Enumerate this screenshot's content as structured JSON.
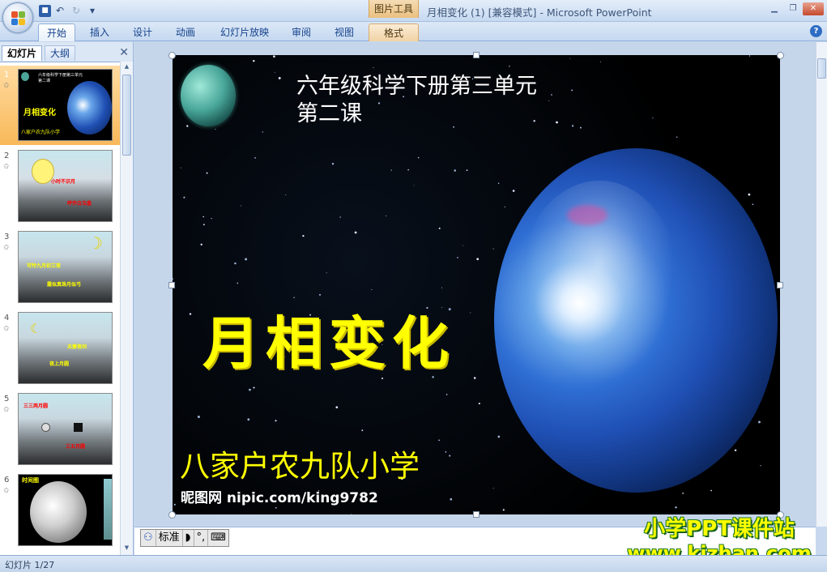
{
  "window": {
    "title": "月相变化 (1) [兼容模式] - Microsoft PowerPoint",
    "context_tab_group": "图片工具"
  },
  "qat": {
    "undo": "↶",
    "redo": "↻",
    "customize": "▾"
  },
  "ribbon": {
    "tabs": [
      "开始",
      "插入",
      "设计",
      "动画",
      "幻灯片放映",
      "审阅",
      "视图"
    ],
    "active_tab": "开始",
    "format_tab": "格式",
    "help": "?"
  },
  "left_panel": {
    "tabs": [
      "幻灯片",
      "大纲"
    ],
    "close": "✕",
    "slides": [
      {
        "num": "1",
        "texts": [
          "六年级科学下册第三单元",
          "第二课",
          "月相变化",
          "八家户农九队小学"
        ]
      },
      {
        "num": "2",
        "texts": [
          "小时不识月",
          "呼作白玉盘"
        ]
      },
      {
        "num": "3",
        "texts": [
          "可怜九月初三夜",
          "露似真珠月似弓"
        ]
      },
      {
        "num": "4",
        "texts": [
          "夫妻夜间",
          "夜上月圆"
        ]
      },
      {
        "num": "5",
        "texts": [
          "三三两月圆",
          "三五月圆"
        ]
      },
      {
        "num": "6",
        "texts": [
          "时间图"
        ]
      }
    ]
  },
  "slide": {
    "title_line1": "六年级科学下册第三单元",
    "title_line2": "第二课",
    "main": "月相变化",
    "school": "八家户农九队小学",
    "watermark": "昵图网 nipic.com/king9782"
  },
  "ime": {
    "icon": "⚇",
    "mode": "标准",
    "moon": "◗",
    "punct": "°,",
    "keyboard": "⌨"
  },
  "status": {
    "slide_count": "幻灯片 1/27"
  },
  "brand": {
    "line1": "小学PPT课件站",
    "line2": "www.kjzhan.com"
  },
  "colors": {
    "accent": "#f8b95a",
    "title_yellow": "#ffff00",
    "ribbon_blue": "#15428b"
  }
}
